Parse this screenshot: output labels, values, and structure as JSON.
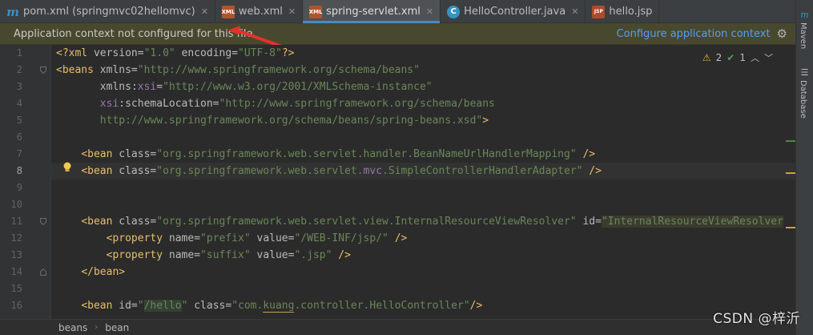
{
  "tabs": [
    {
      "label": "pom.xml (springmvc02hellomvc)",
      "icon": "maven-module-icon",
      "glyph": "m",
      "active": false
    },
    {
      "label": "web.xml",
      "icon": "xml-file-icon",
      "glyph": "XML",
      "active": false
    },
    {
      "label": "spring-servlet.xml",
      "icon": "spring-xml-icon",
      "glyph": "XML",
      "active": true
    },
    {
      "label": "HelloController.java",
      "icon": "java-class-icon",
      "glyph": "C",
      "active": false
    },
    {
      "label": "hello.jsp",
      "icon": "jsp-file-icon",
      "glyph": "JSP",
      "active": false
    }
  ],
  "right_strip": {
    "maven": "Maven",
    "database": "Database"
  },
  "banner": {
    "message": "Application context not configured for this file",
    "action": "Configure application context",
    "gear_icon": "gear-icon"
  },
  "inspection": {
    "warnings": "2",
    "weak_warnings": "1"
  },
  "lines": [
    {
      "n": "1"
    },
    {
      "n": "2"
    },
    {
      "n": "3"
    },
    {
      "n": "4"
    },
    {
      "n": "5"
    },
    {
      "n": "6"
    },
    {
      "n": "7"
    },
    {
      "n": "8"
    },
    {
      "n": "9"
    },
    {
      "n": "10"
    },
    {
      "n": "11"
    },
    {
      "n": "12"
    },
    {
      "n": "13"
    },
    {
      "n": "14"
    },
    {
      "n": "15"
    },
    {
      "n": "16"
    }
  ],
  "code": {
    "l1": {
      "open": "<?xml",
      "a1": " version=",
      "v1": "\"1.0\"",
      "a2": " encoding=",
      "v2": "\"UTF-8\"",
      "close": "?>"
    },
    "l2": {
      "tag": "<beans",
      "attr": " xmlns=",
      "val": "\"http://www.springframework.org/schema/beans\""
    },
    "l3": {
      "indent": "       ",
      "ns": "xmlns",
      "colon": ":",
      "ns2": "xsi",
      "eq": "=",
      "val": "\"http://www.w3.org/2001/XMLSchema-instance\""
    },
    "l4": {
      "indent": "       ",
      "ns": "xsi",
      "attr": ":schemaLocation=",
      "val": "\"http://www.springframework.org/schema/beans"
    },
    "l5": {
      "indent": "       ",
      "val": "http://www.springframework.org/schema/beans/spring-beans.xsd\"",
      "close": ">"
    },
    "l7": {
      "indent": "    ",
      "tag": "<bean",
      "attr": " class=",
      "val": "\"org.springframework.web.servlet.handler.BeanNameUrlHandlerMapping\"",
      "close": " />"
    },
    "l8": {
      "indent": "    ",
      "tag": "<bean",
      "attr": " class=",
      "val1": "\"org.springframework.web.servlet.",
      "mvc": "mvc",
      "val2": ".SimpleControllerHandlerAdapter\"",
      "close": " />"
    },
    "l11": {
      "indent": "    ",
      "tag": "<bean",
      "attr": " class=",
      "val": "\"org.springframework.web.servlet.view.InternalResourceViewResolver\"",
      "attr2": " id=",
      "val2": "\"InternalResourceViewResolver"
    },
    "l12": {
      "indent": "        ",
      "tag": "<property",
      "a1": " name=",
      "v1": "\"prefix\"",
      "a2": " value=",
      "v2": "\"/WEB-INF/jsp/\"",
      "close": " />"
    },
    "l13": {
      "indent": "        ",
      "tag": "<property",
      "a1": " name=",
      "v1": "\"suffix\"",
      "a2": " value=",
      "v2": "\".jsp\"",
      "close": " />"
    },
    "l14": {
      "indent": "    ",
      "tag": "</bean>"
    },
    "l16": {
      "indent": "    ",
      "tag": "<bean",
      "a1": " id=",
      "q1": "\"",
      "v1": "/hello",
      "q2": "\"",
      "a2": " class=",
      "v2a": "\"com.",
      "v2b": "kuang",
      "v2c": ".controller.HelloController\"",
      "close": "/>"
    }
  },
  "breadcrumb": [
    "beans",
    "bean"
  ],
  "watermark": "CSDN @梓沂",
  "colors": {
    "accent": "#4a88c7",
    "tag": "#e8bf6a",
    "string": "#6a8759",
    "namespace": "#9876aa",
    "link": "#589df6",
    "arrow": "#e8302a"
  }
}
